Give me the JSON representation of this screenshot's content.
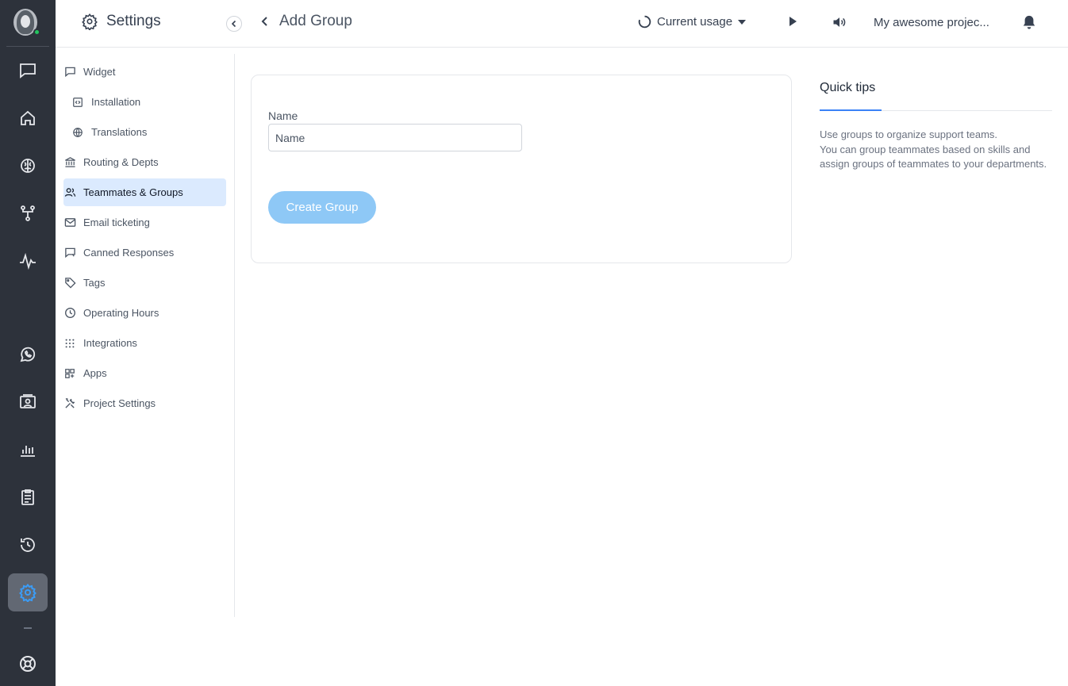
{
  "header": {
    "settings_title": "Settings",
    "page_title": "Add Group",
    "usage_label": "Current usage",
    "project_name": "My awesome projec..."
  },
  "sidebar": {
    "items": [
      {
        "label": "Widget",
        "icon": "widget-icon"
      },
      {
        "label": "Installation",
        "icon": "code-icon"
      },
      {
        "label": "Translations",
        "icon": "globe-icon"
      },
      {
        "label": "Routing & Depts",
        "icon": "bank-icon"
      },
      {
        "label": "Teammates & Groups",
        "icon": "users-icon",
        "active": true
      },
      {
        "label": "Email ticketing",
        "icon": "mail-icon"
      },
      {
        "label": "Canned Responses",
        "icon": "canned-icon"
      },
      {
        "label": "Tags",
        "icon": "tag-icon"
      },
      {
        "label": "Operating Hours",
        "icon": "clock-icon"
      },
      {
        "label": "Integrations",
        "icon": "grid-dots-icon"
      },
      {
        "label": "Apps",
        "icon": "apps-icon"
      },
      {
        "label": "Project Settings",
        "icon": "tools-icon"
      }
    ]
  },
  "form": {
    "name_label": "Name",
    "name_placeholder": "Name",
    "name_value": "",
    "create_button": "Create Group"
  },
  "tips": {
    "title": "Quick tips",
    "line1": "Use groups to organize support teams.",
    "line2": "You can group teammates based on skills and assign groups of teammates to your departments."
  },
  "colors": {
    "rail_bg": "#2d323b",
    "accent": "#3b82f6",
    "active_nav_bg": "#dbeafe",
    "button_disabled": "#8ec8f6",
    "online": "#22c55e"
  }
}
